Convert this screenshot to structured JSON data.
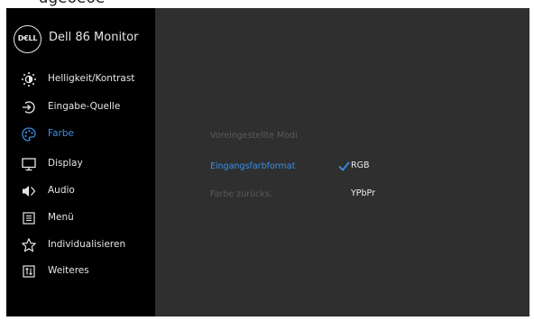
{
  "caption": "- - - ugeoeoe- - - - - - - -",
  "header": {
    "logo_text": "D€LL",
    "model": "Dell 86 Monitor"
  },
  "menu": [
    {
      "label": "Helligkeit/Kontrast",
      "icon": "brightness-icon",
      "active": false
    },
    {
      "label": "Eingabe-Quelle",
      "icon": "input-source-icon",
      "active": false
    },
    {
      "label": "Farbe",
      "icon": "palette-icon",
      "active": true
    },
    {
      "label": "Display",
      "icon": "display-icon",
      "active": false
    },
    {
      "label": "Audio",
      "icon": "speaker-icon",
      "active": false
    },
    {
      "label": "Menü",
      "icon": "menu-list-icon",
      "active": false
    },
    {
      "label": "Individualisieren",
      "icon": "star-icon",
      "active": false
    },
    {
      "label": "Weiteres",
      "icon": "others-icon",
      "active": false
    }
  ],
  "submenu": {
    "preset_modes": "Voreingestellte Modi",
    "input_color_format": "Eingangsfarbformat",
    "reset_color": "Farbe zurücks."
  },
  "options": {
    "rgb": "RGB",
    "ypbpr": "YPbPr",
    "selected": "RGB"
  },
  "colors": {
    "accent": "#3a8ee6",
    "sidebar_bg": "#000000",
    "panel_bg": "#2f2f2f",
    "text": "#e6e6e6",
    "dim_text": "#5a5a5a"
  }
}
